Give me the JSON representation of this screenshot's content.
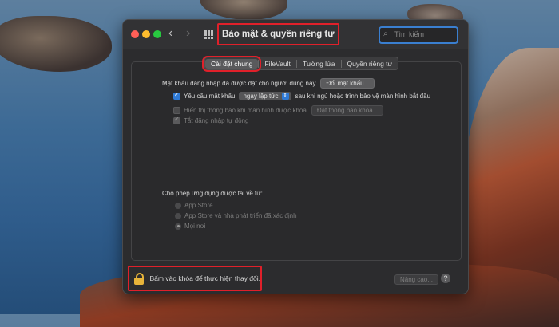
{
  "window": {
    "title": "Bảo mật & quyền riêng tư",
    "search_placeholder": "Tìm kiếm"
  },
  "tabs": [
    "Cài đặt chung",
    "FileVault",
    "Tường lửa",
    "Quyền riêng tư"
  ],
  "general": {
    "login_password_label": "Mật khẩu đăng nhập đã được đặt cho người dùng này",
    "change_password_button": "Đổi mật khẩu...",
    "require_password_label": "Yêu cầu mật khẩu",
    "require_password_select": "ngay lập tức",
    "require_password_suffix": "sau khi ngủ hoặc trình bảo vệ màn hình bắt đầu",
    "show_message_label": "Hiển thị thông báo khi màn hình được khóa",
    "set_message_button": "Đặt thông báo khóa...",
    "disable_auto_login_label": "Tắt đăng nhập tự động"
  },
  "downloads": {
    "heading": "Cho phép ứng dụng được tải về từ:",
    "options": [
      "App Store",
      "App Store và nhà phát triển đã xác định",
      "Mọi nơi"
    ],
    "selected_index": 2
  },
  "footer": {
    "lock_text": "Bấm vào khóa để thực hiện thay đổi.",
    "advanced_button": "Nâng cao...",
    "help_button": "?"
  },
  "colors": {
    "highlight_red": "#e0202a",
    "accent_blue": "#2f7ad6",
    "lock_gold": "#e7b43a"
  }
}
